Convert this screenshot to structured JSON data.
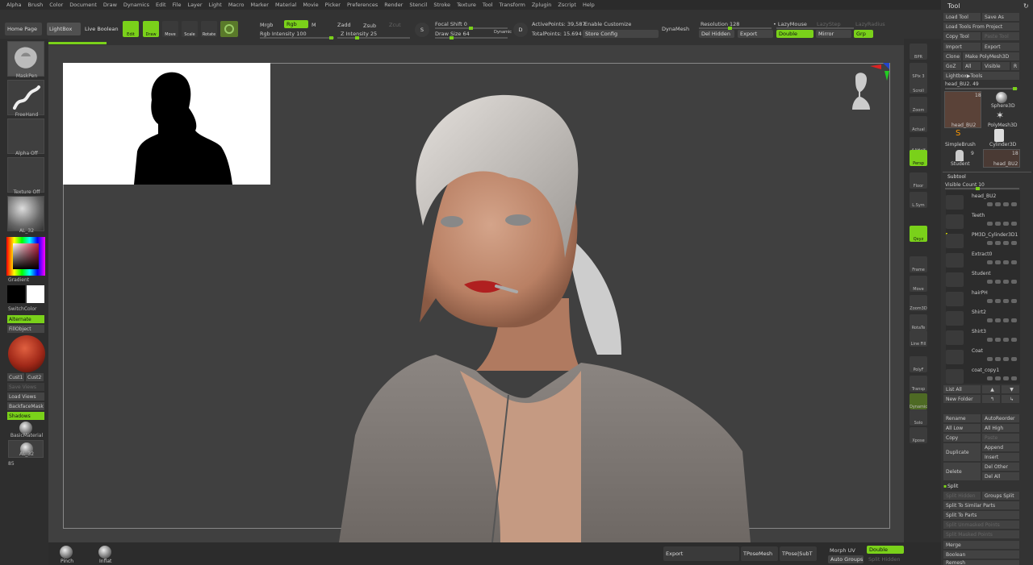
{
  "menu": [
    "Alpha",
    "Brush",
    "Color",
    "Document",
    "Draw",
    "Dynamics",
    "Edit",
    "File",
    "Layer",
    "Light",
    "Macro",
    "Marker",
    "Material",
    "Movie",
    "Picker",
    "Preferences",
    "Render",
    "Stencil",
    "Stroke",
    "Texture",
    "Tool",
    "Transform",
    "Zplugin",
    "Zscript",
    "Help"
  ],
  "top": {
    "home": "Home Page",
    "lightbox": "LightBox",
    "live_boolean": "Live Boolean",
    "edit": "Edit",
    "draw": "Draw",
    "move": "Move",
    "scale": "Scale",
    "rotate": "Rotate",
    "mrgb": "Mrgb",
    "rgb": "Rgb",
    "m": "M",
    "rgb_intensity": "Rgb Intensity 100",
    "zadd": "Zadd",
    "zsub": "Zsub",
    "zcut": "Zcut",
    "z_intensity": "Z Intensity 25",
    "focal_shift": "Focal Shift 0",
    "draw_size": "Draw Size 64",
    "dynamic": "Dynamic",
    "active_points": "ActivePoints: 39,587",
    "total_points": "TotalPoints: 15.694 Mil",
    "enable_customize": "Enable Customize",
    "store_config": "Store Config",
    "dynamesh": "DynaMesh",
    "resolution": "Resolution 128",
    "del_hidden": "Del Hidden",
    "export": "Export",
    "lazymouse": "LazyMouse",
    "lazystep": "LazyStep",
    "lazyradius": "LazyRadius",
    "double": "Double",
    "mirror": "Mirror",
    "grp": "Grp"
  },
  "left": {
    "brush": "MaskPen",
    "stroke": "FreeHand",
    "alpha": "Alpha Off",
    "texture": "Texture Off",
    "material": "AL_32",
    "gradient": "Gradient",
    "switchcolor": "SwitchColor",
    "alternate": "Alternate",
    "fillobject": "FillObject",
    "cust1": "Cust1",
    "cust2": "Cust2",
    "save_views": "Save Views",
    "load_views": "Load Views",
    "backface": "BackfaceMask",
    "shadows": "Shadows",
    "basicmaterial": "BasicMaterial",
    "al32": "AL_32",
    "num": "85"
  },
  "right_shelf": [
    "BPR",
    "SPix 3",
    "Scroll",
    "Zoom",
    "Actual",
    "AAHalf",
    "Persp",
    "Floor",
    "L.Sym",
    "Qxyz",
    "Frame",
    "Move",
    "Zoom3D",
    "RotaTe",
    "Line Fill",
    "PolyF",
    "Transp",
    "Dynamic",
    "Solo",
    "Xpose"
  ],
  "bottom": {
    "pinch": "Pinch",
    "inflat": "Inflat",
    "export": "Export",
    "tposemesh": "TPoseMesh",
    "tpose_subt": "TPose|SubT",
    "morph_uv": "Morph UV",
    "double": "Double",
    "auto_groups": "Auto Groups",
    "split_hidden": "Split Hidden"
  },
  "panel": {
    "title": "Tool",
    "load_tool": "Load Tool",
    "save_as": "Save As",
    "load_from_project": "Load Tools From Project",
    "copy_tool": "Copy Tool",
    "paste_tool": "Paste Tool",
    "import": "Import",
    "export": "Export",
    "clone": "Clone",
    "make_polymesh": "Make PolyMesh3D",
    "goz": "GoZ",
    "all": "All",
    "visible": "Visible",
    "r": "R",
    "lightbox_tools": "Lightbox▶Tools",
    "current_tool": "head_BU2. 49",
    "tools": [
      {
        "name": "head_BU2",
        "count": "18"
      },
      {
        "name": "Sphere3D",
        "count": ""
      },
      {
        "name": "SimpleBrush",
        "count": ""
      },
      {
        "name": "PolyMesh3D",
        "count": ""
      },
      {
        "name": "Student",
        "count": "9"
      },
      {
        "name": "Cylinder3D",
        "count": ""
      },
      {
        "name": "head_BU2",
        "count": "18"
      }
    ],
    "subtool": "Subtool",
    "visible_count": "Visible Count 10",
    "subtools": [
      "head_BU2",
      "Teeth",
      "PM3D_Cylinder3D1",
      "Extract0",
      "Student",
      "hairPH",
      "Shirt2",
      "Shirt3",
      "Coat",
      "coat_copy1"
    ],
    "list_all": "List All",
    "new_folder": "New Folder",
    "rename": "Rename",
    "autoreorder": "AutoReorder",
    "all_low": "All Low",
    "all_high": "All High",
    "copy": "Copy",
    "paste": "Paste",
    "duplicate": "Duplicate",
    "append": "Append",
    "insert": "Insert",
    "delete": "Delete",
    "del_other": "Del Other",
    "del_all": "Del All",
    "split": "Split",
    "split_hidden": "Split Hidden",
    "groups_split": "Groups Split",
    "split_similar": "Split To Similar Parts",
    "split_parts": "Split To Parts",
    "split_unmasked": "Split Unmasked Points",
    "split_masked": "Split Masked Points",
    "merge": "Merge",
    "boolean": "Boolean",
    "remesh": "Remesh"
  }
}
